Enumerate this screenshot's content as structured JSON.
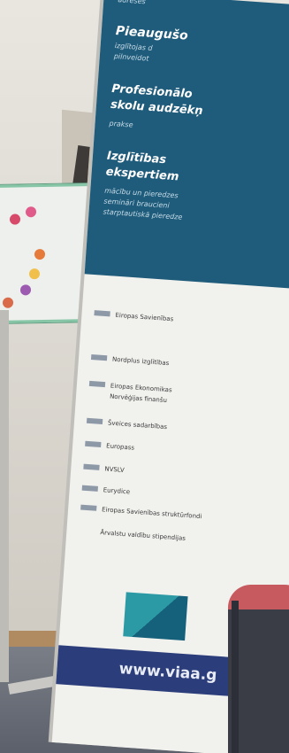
{
  "scene": {
    "description_free_text_removed": true
  },
  "banner": {
    "top_text": [
      "adreses",
      "Pieaugušo",
      "izglītojas d",
      "pilnveidot",
      "Profesionālo",
      "skolu audzēkņ",
      "prakse",
      "Izglītības",
      "ekspertiem",
      "mācību un pieredzes",
      "semināri braucieni",
      "starptautiskā pieredze"
    ],
    "list_rows": [
      "Eiropas Savienības",
      "Nordplus izglītības",
      "Eiropas Ekonomikas",
      "Norvēģijas finanšu",
      "Šveices sadarbības",
      "Europass",
      "NVSLV",
      "Eurydice",
      "Eiropas Savienības struktūrfondi",
      "Ārvalstu valdību stipendijas"
    ],
    "website": "www.viaa.g"
  }
}
